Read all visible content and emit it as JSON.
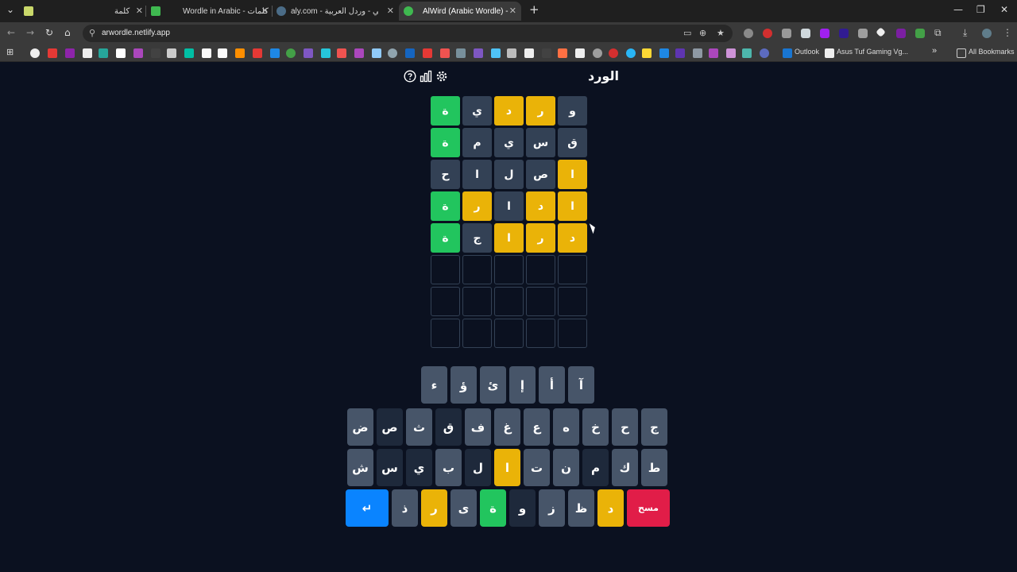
{
  "browser": {
    "tabs": [
      {
        "title": "كلمة"
      },
      {
        "title": "Wordle in Arabic - كلمات"
      },
      {
        "title": "aly.com - كلمالي - وردل العربية"
      },
      {
        "title": "AlWird (Arabic Wordle) - الورد"
      }
    ],
    "url": "arwordle.netlify.app",
    "bookmarks": {
      "outlook": "Outlook",
      "asus": "Asus Tuf Gaming Vg...",
      "all": "All Bookmarks"
    }
  },
  "game": {
    "title": "الورد",
    "board": [
      [
        {
          "l": "و",
          "s": "gray"
        },
        {
          "l": "ر",
          "s": "yellow"
        },
        {
          "l": "د",
          "s": "yellow"
        },
        {
          "l": "ي",
          "s": "gray"
        },
        {
          "l": "ة",
          "s": "green"
        }
      ],
      [
        {
          "l": "ق",
          "s": "gray"
        },
        {
          "l": "س",
          "s": "gray"
        },
        {
          "l": "ي",
          "s": "gray"
        },
        {
          "l": "م",
          "s": "gray"
        },
        {
          "l": "ة",
          "s": "green"
        }
      ],
      [
        {
          "l": "ا",
          "s": "yellow"
        },
        {
          "l": "ص",
          "s": "gray"
        },
        {
          "l": "ل",
          "s": "gray"
        },
        {
          "l": "ا",
          "s": "gray"
        },
        {
          "l": "ح",
          "s": "gray"
        }
      ],
      [
        {
          "l": "ا",
          "s": "yellow"
        },
        {
          "l": "د",
          "s": "yellow"
        },
        {
          "l": "ا",
          "s": "gray"
        },
        {
          "l": "ر",
          "s": "yellow"
        },
        {
          "l": "ة",
          "s": "green"
        }
      ],
      [
        {
          "l": "د",
          "s": "yellow"
        },
        {
          "l": "ر",
          "s": "yellow"
        },
        {
          "l": "ا",
          "s": "yellow"
        },
        {
          "l": "ج",
          "s": "gray"
        },
        {
          "l": "ة",
          "s": "green"
        }
      ],
      [
        {
          "l": "",
          "s": "empty"
        },
        {
          "l": "",
          "s": "empty"
        },
        {
          "l": "",
          "s": "empty"
        },
        {
          "l": "",
          "s": "empty"
        },
        {
          "l": "",
          "s": "empty"
        }
      ],
      [
        {
          "l": "",
          "s": "empty"
        },
        {
          "l": "",
          "s": "empty"
        },
        {
          "l": "",
          "s": "empty"
        },
        {
          "l": "",
          "s": "empty"
        },
        {
          "l": "",
          "s": "empty"
        }
      ],
      [
        {
          "l": "",
          "s": "empty"
        },
        {
          "l": "",
          "s": "empty"
        },
        {
          "l": "",
          "s": "empty"
        },
        {
          "l": "",
          "s": "empty"
        },
        {
          "l": "",
          "s": "empty"
        }
      ]
    ],
    "keyboard": {
      "row1": [
        {
          "l": "آ",
          "s": "def"
        },
        {
          "l": "أ",
          "s": "def"
        },
        {
          "l": "إ",
          "s": "def"
        },
        {
          "l": "ئ",
          "s": "def"
        },
        {
          "l": "ؤ",
          "s": "def"
        },
        {
          "l": "ء",
          "s": "def"
        }
      ],
      "row2": [
        {
          "l": "ج",
          "s": "def"
        },
        {
          "l": "ح",
          "s": "def"
        },
        {
          "l": "خ",
          "s": "def"
        },
        {
          "l": "ه",
          "s": "def"
        },
        {
          "l": "ع",
          "s": "def"
        },
        {
          "l": "غ",
          "s": "def"
        },
        {
          "l": "ف",
          "s": "def"
        },
        {
          "l": "ق",
          "s": "dark"
        },
        {
          "l": "ث",
          "s": "def"
        },
        {
          "l": "ص",
          "s": "dark"
        },
        {
          "l": "ض",
          "s": "def"
        }
      ],
      "row3": [
        {
          "l": "ط",
          "s": "def"
        },
        {
          "l": "ك",
          "s": "def"
        },
        {
          "l": "م",
          "s": "dark"
        },
        {
          "l": "ن",
          "s": "def"
        },
        {
          "l": "ت",
          "s": "def"
        },
        {
          "l": "ا",
          "s": "yellow"
        },
        {
          "l": "ل",
          "s": "dark"
        },
        {
          "l": "ب",
          "s": "def"
        },
        {
          "l": "ي",
          "s": "dark"
        },
        {
          "l": "س",
          "s": "dark"
        },
        {
          "l": "ش",
          "s": "def"
        }
      ],
      "row4": [
        {
          "l": "مسح",
          "s": "del"
        },
        {
          "l": "د",
          "s": "yellow"
        },
        {
          "l": "ظ",
          "s": "def"
        },
        {
          "l": "ز",
          "s": "def"
        },
        {
          "l": "و",
          "s": "dark"
        },
        {
          "l": "ة",
          "s": "green"
        },
        {
          "l": "ى",
          "s": "def"
        },
        {
          "l": "ر",
          "s": "yellow"
        },
        {
          "l": "ذ",
          "s": "def"
        },
        {
          "l": "↵",
          "s": "enter"
        }
      ]
    }
  }
}
